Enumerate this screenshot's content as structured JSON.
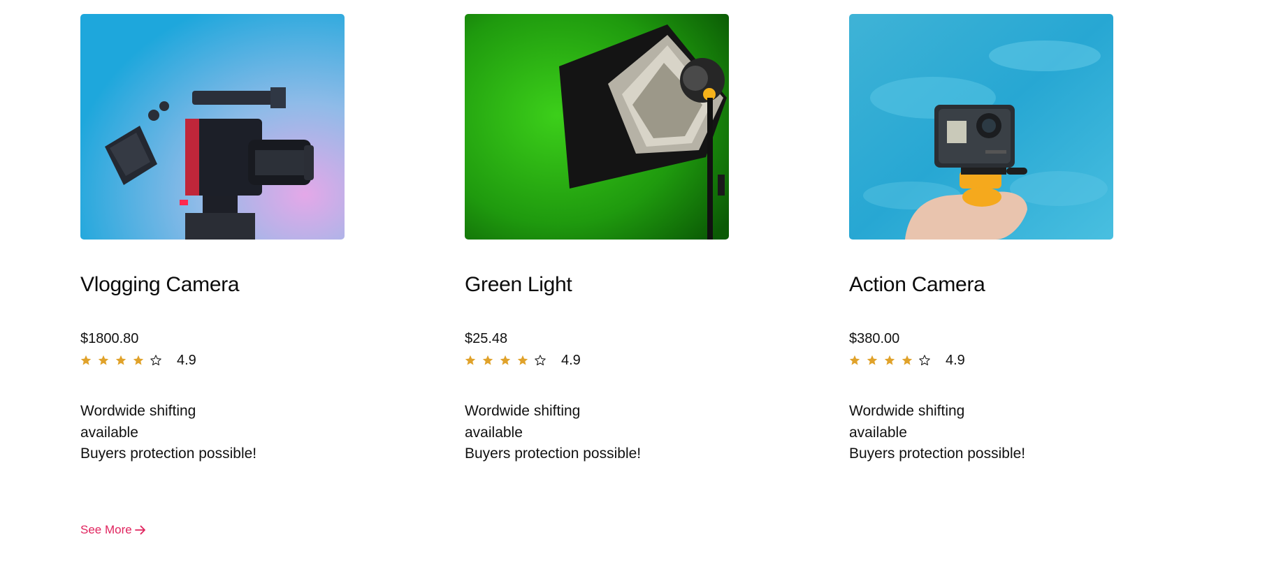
{
  "products": [
    {
      "name": "Vlogging Camera",
      "price": "$1800.80",
      "rating_value": "4.9",
      "stars_filled": 4,
      "stars_total": 5,
      "shipping": "Wordwide shifting available",
      "protection": "Buyers protection possible!",
      "image": "vlogging-camera-image"
    },
    {
      "name": "Green Light",
      "price": "$25.48",
      "rating_value": "4.9",
      "stars_filled": 4,
      "stars_total": 5,
      "shipping": "Wordwide shifting available",
      "protection": "Buyers protection possible!",
      "image": "green-light-image"
    },
    {
      "name": "Action Camera",
      "price": "$380.00",
      "rating_value": "4.9",
      "stars_filled": 4,
      "stars_total": 5,
      "shipping": "Wordwide shifting available",
      "protection": "Buyers protection possible!",
      "image": "action-camera-image"
    }
  ],
  "see_more": {
    "label": "See More",
    "icon": "arrow-right-icon"
  },
  "colors": {
    "star": "#e0a22a",
    "accent": "#e0245e"
  }
}
